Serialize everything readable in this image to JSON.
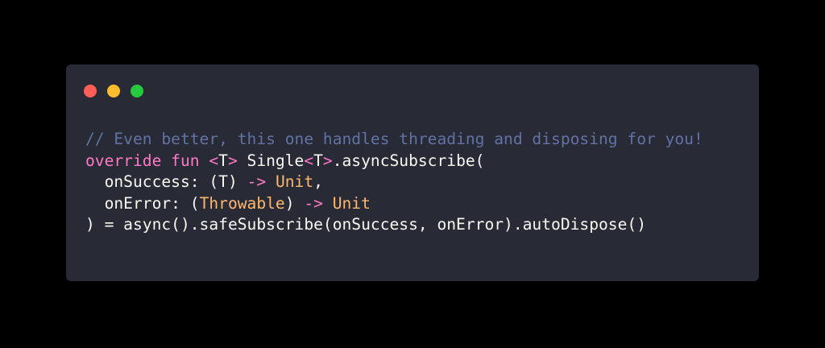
{
  "window": {
    "background": "#282a36",
    "controls": [
      {
        "name": "close",
        "color": "#ff5f56"
      },
      {
        "name": "minimize",
        "color": "#ffbd2e"
      },
      {
        "name": "maximize",
        "color": "#27c93f"
      }
    ]
  },
  "colors": {
    "comment": "#6272a4",
    "keyword": "#ff79c6",
    "type": "#ffb86c",
    "plain": "#f8f8f2"
  },
  "code": {
    "lines": [
      [
        {
          "k": "comment",
          "t": "// Even better, this one handles threading and disposing for you!"
        }
      ],
      [
        {
          "k": "keyword",
          "t": "override fun "
        },
        {
          "k": "keyword",
          "t": "<"
        },
        {
          "k": "plain",
          "t": "T"
        },
        {
          "k": "keyword",
          "t": ">"
        },
        {
          "k": "plain",
          "t": " Single"
        },
        {
          "k": "keyword",
          "t": "<"
        },
        {
          "k": "plain",
          "t": "T"
        },
        {
          "k": "keyword",
          "t": ">"
        },
        {
          "k": "plain",
          "t": ".asyncSubscribe("
        }
      ],
      [
        {
          "k": "plain",
          "t": "  onSuccess: (T) "
        },
        {
          "k": "keyword",
          "t": "->"
        },
        {
          "k": "plain",
          "t": " "
        },
        {
          "k": "type",
          "t": "Unit"
        },
        {
          "k": "plain",
          "t": ","
        }
      ],
      [
        {
          "k": "plain",
          "t": "  onError: ("
        },
        {
          "k": "type",
          "t": "Throwable"
        },
        {
          "k": "plain",
          "t": ") "
        },
        {
          "k": "keyword",
          "t": "->"
        },
        {
          "k": "plain",
          "t": " "
        },
        {
          "k": "type",
          "t": "Unit"
        }
      ],
      [
        {
          "k": "plain",
          "t": ") = async().safeSubscribe(onSuccess, onError).autoDispose()"
        }
      ]
    ]
  }
}
